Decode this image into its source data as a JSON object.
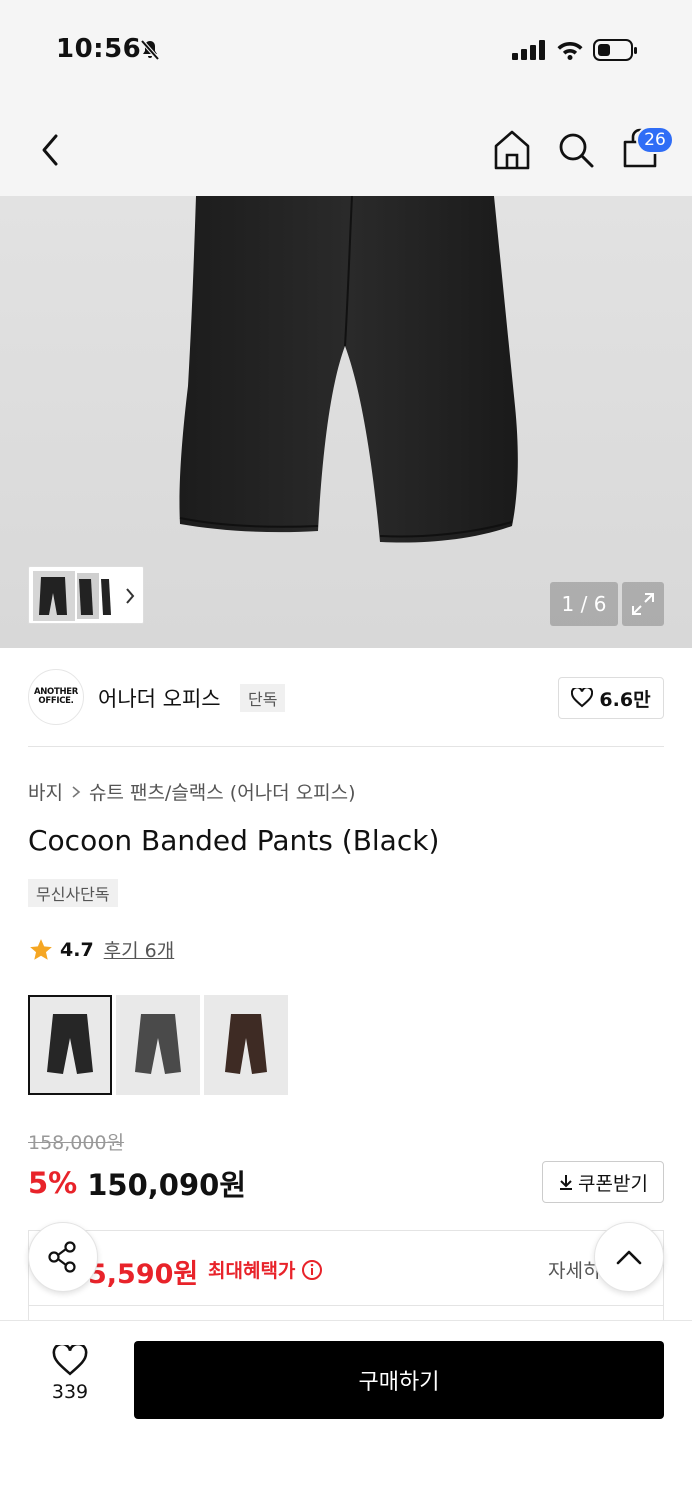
{
  "status": {
    "time": "10:56"
  },
  "nav": {
    "cart_count": "26"
  },
  "gallery": {
    "page_counter": "1 / 6"
  },
  "brand": {
    "logo_line1": "ANOTHER",
    "logo_line2": "OFFICE.",
    "name": "어나더 오피스",
    "exclusive": "단독",
    "likes": "6.6만"
  },
  "product": {
    "breadcrumb": [
      "바지",
      "슈트 팬츠/슬랙스 (어나더 오피스)"
    ],
    "title": "Cocoon Banded Pants (Black)",
    "tag": "무신사단독",
    "rating": "4.7",
    "review_link": "후기 6개",
    "swatches": [
      {
        "color": "#262626",
        "selected": true
      },
      {
        "color": "#4a4a4a",
        "selected": false
      },
      {
        "color": "#3e2b24",
        "selected": false
      }
    ]
  },
  "price": {
    "original": "158,000원",
    "discount": "5%",
    "sale": "150,090원",
    "coupon_label": "쿠폰받기"
  },
  "benefit": {
    "amount": "5,590원",
    "label": "최대혜택가",
    "detail": "자세히"
  },
  "bottom": {
    "wish_count": "339",
    "buy_label": "구매하기"
  },
  "colors": {
    "accent_red": "#e8232a",
    "badge_blue": "#2f6df6"
  }
}
